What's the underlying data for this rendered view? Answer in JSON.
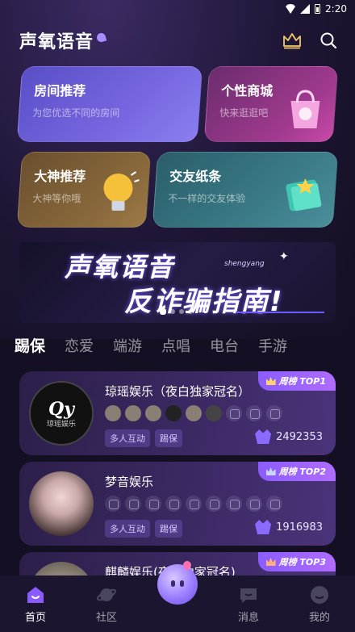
{
  "status_bar": {
    "time": "2:20"
  },
  "header": {
    "title": "声氧语音"
  },
  "categories": [
    {
      "title": "房间推荐",
      "subtitle": "为您优选不同的房间"
    },
    {
      "title": "个性商城",
      "subtitle": "快来逛逛吧"
    },
    {
      "title": "大神推荐",
      "subtitle": "大神等你哦"
    },
    {
      "title": "交友纸条",
      "subtitle": "不一样的交友体验"
    }
  ],
  "banner": {
    "line1": "声氧语音",
    "pinyin": "shengyang",
    "line2": "反诈骗指南!",
    "page_count": 4,
    "active_page": 1
  },
  "tabs": [
    {
      "label": "踢保",
      "active": true
    },
    {
      "label": "恋爱",
      "active": false
    },
    {
      "label": "端游",
      "active": false
    },
    {
      "label": "点唱",
      "active": false
    },
    {
      "label": "电台",
      "active": false
    },
    {
      "label": "手游",
      "active": false
    }
  ],
  "rooms": [
    {
      "name": "琼瑶娱乐（夜白独家冠名）",
      "rank": "周榜 TOP1",
      "logo_text": "Qy",
      "logo_sub": "琼瑶娱乐",
      "tags": [
        "多人互动",
        "踢保"
      ],
      "heat": "2492353"
    },
    {
      "name": "梦音娱乐",
      "rank": "周榜 TOP2",
      "tags": [
        "多人互动",
        "踢保"
      ],
      "heat": "1916983"
    },
    {
      "name": "麒麟娱乐(夜白独家冠名)",
      "rank": "周榜 TOP3"
    }
  ],
  "bottom_nav": [
    {
      "label": "首页",
      "icon": "home-icon",
      "active": true
    },
    {
      "label": "社区",
      "icon": "planet-icon",
      "active": false
    },
    {
      "label": "",
      "icon": "center-mascot-icon",
      "active": false
    },
    {
      "label": "消息",
      "icon": "message-icon",
      "active": false
    },
    {
      "label": "我的",
      "icon": "profile-icon",
      "active": false
    }
  ],
  "colors": {
    "background": "#140f22",
    "accent": "#8a5cff",
    "nav_bg": "#1b1530"
  }
}
